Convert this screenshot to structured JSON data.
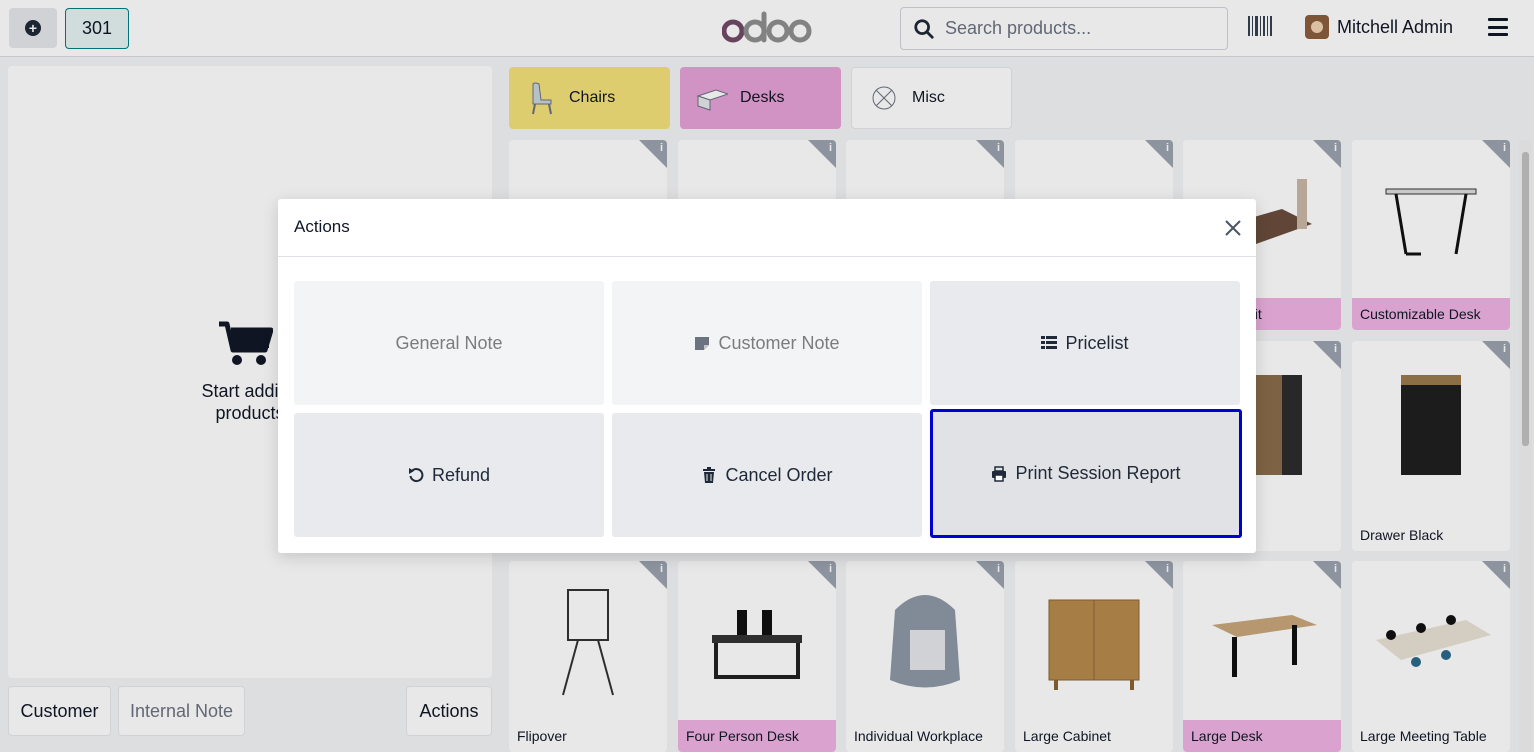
{
  "topbar": {
    "order_number": "301",
    "logo_text": "odoo",
    "search_placeholder": "Search products...",
    "user_name": "Mitchell Admin"
  },
  "left_panel": {
    "empty_message_line1": "Start adding",
    "empty_message_line2": "products"
  },
  "bottom_buttons": {
    "customer": "Customer",
    "internal_note": "Internal Note",
    "actions": "Actions"
  },
  "categories": [
    {
      "label": "Chairs",
      "color": "#f4e27a"
    },
    {
      "label": "Desks",
      "color": "#e6a1d8"
    },
    {
      "label": "Misc",
      "color": "#ffffff"
    }
  ],
  "products": [
    {
      "name": "Customizable Desk",
      "highlight": true
    },
    {
      "name": "Drawer Black",
      "highlight": false
    },
    {
      "name": "Flipover",
      "highlight": false
    },
    {
      "name": "Four Person Desk",
      "highlight": true
    },
    {
      "name": "Individual Workplace",
      "highlight": false
    },
    {
      "name": "Large Cabinet",
      "highlight": false
    },
    {
      "name": "Large Desk",
      "highlight": true
    },
    {
      "name": "Large Meeting Table",
      "highlight": false
    },
    {
      "name": "sk Right Sit",
      "highlight": true
    }
  ],
  "modal": {
    "title": "Actions",
    "buttons": [
      {
        "label": "General Note",
        "icon": "none",
        "state": "disabled"
      },
      {
        "label": "Customer Note",
        "icon": "note-icon",
        "state": "disabled"
      },
      {
        "label": "Pricelist",
        "icon": "list-icon",
        "state": "enabled"
      },
      {
        "label": "Refund",
        "icon": "undo-icon",
        "state": "enabled"
      },
      {
        "label": "Cancel Order",
        "icon": "trash-icon",
        "state": "enabled"
      },
      {
        "label": "Print Session Report",
        "icon": "printer-icon",
        "state": "focused"
      }
    ]
  },
  "colors": {
    "accent": "#017e84",
    "brand": "#714b67",
    "focus_outline": "#0000d6",
    "category_highlight": "#f0b4e4"
  }
}
